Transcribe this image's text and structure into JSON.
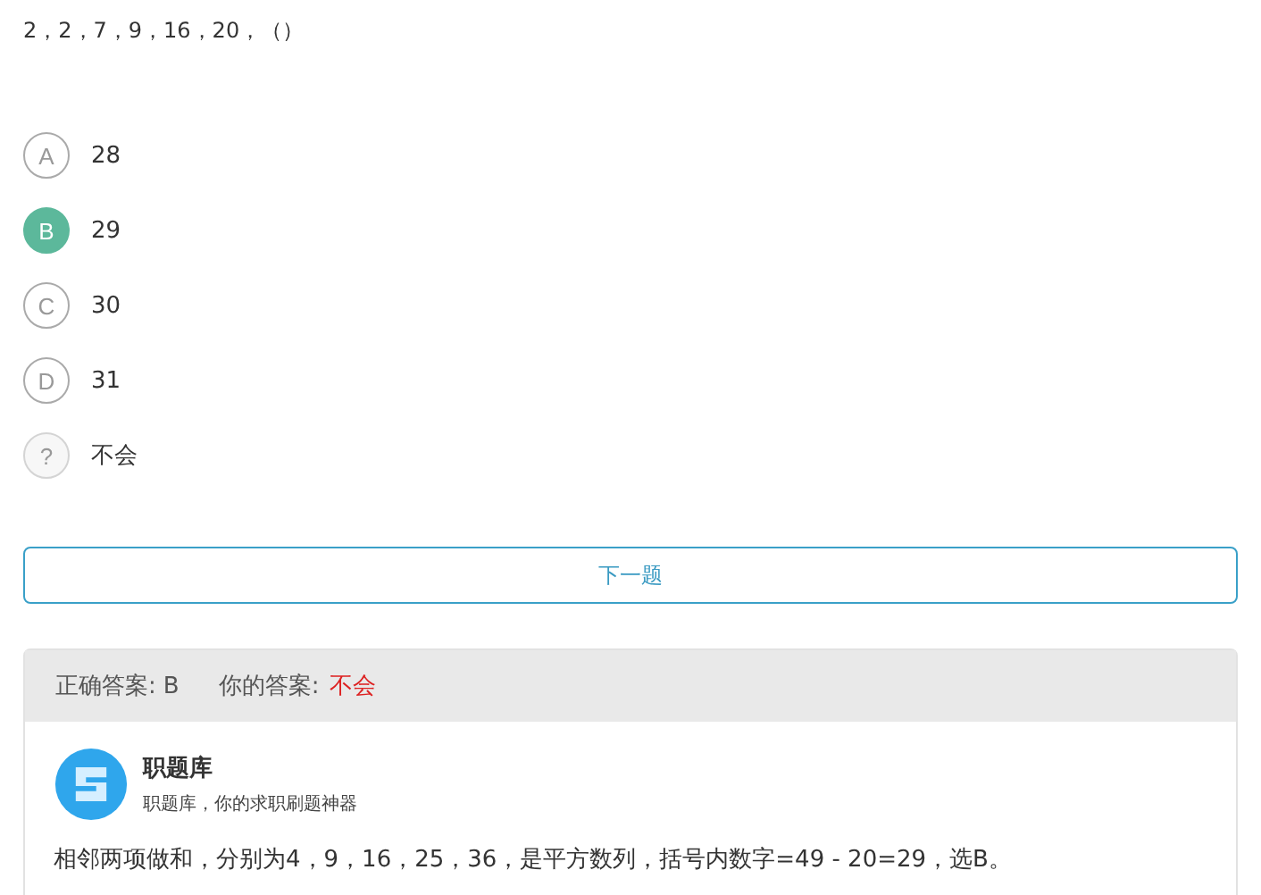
{
  "question": "2，2，7，9，16，20，（）",
  "options": [
    {
      "kind": "letter",
      "letter": "A",
      "text": "28",
      "selected": false
    },
    {
      "kind": "letter",
      "letter": "B",
      "text": "29",
      "selected": true
    },
    {
      "kind": "letter",
      "letter": "C",
      "text": "30",
      "selected": false
    },
    {
      "kind": "letter",
      "letter": "D",
      "text": "31",
      "selected": false
    },
    {
      "kind": "unknown",
      "letter": "?",
      "text": "不会",
      "selected": false
    }
  ],
  "next_button": "下一题",
  "answer": {
    "correct_label": "正确答案:",
    "correct": "B",
    "yours_label": "你的答案:",
    "yours": "不会"
  },
  "source": {
    "name": "职题库",
    "tagline": "职题库，你的求职刷题神器"
  },
  "explanation": "相邻两项做和，分别为4，9，16，25，36，是平方数列，括号内数字=49 - 20=29，选B。"
}
